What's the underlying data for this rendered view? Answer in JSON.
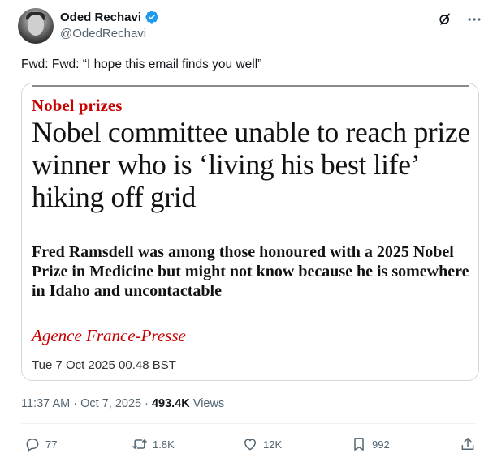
{
  "author": {
    "name": "Oded Rechavi",
    "handle": "@OdedRechavi",
    "verified_color": "#1d9bf0"
  },
  "tweet": {
    "text": "Fwd: Fwd: “I hope this email finds you well”"
  },
  "card": {
    "kicker": "Nobel prizes",
    "headline": "Nobel committee unable to reach prize winner who is ‘living his best life’ hiking off grid",
    "standfirst": "Fred Ramsdell was among those honoured with a 2025 Nobel Prize in Medicine but might not know because he is somewhere in Idaho and uncontactable",
    "byline": "Agence France-Presse",
    "date": "Tue 7 Oct 2025 00.48 BST",
    "accent_color": "#c70000"
  },
  "meta": {
    "time": "11:37 AM",
    "separator": "·",
    "date": "Oct 7, 2025",
    "views_count": "493.4K",
    "views_label": "Views"
  },
  "actions": {
    "replies": "77",
    "reposts": "1.8K",
    "likes": "12K",
    "bookmarks": "992"
  },
  "icons": [
    "grok-icon",
    "more-icon",
    "reply-icon",
    "repost-icon",
    "like-icon",
    "bookmark-icon",
    "share-icon",
    "verified-badge-icon"
  ]
}
